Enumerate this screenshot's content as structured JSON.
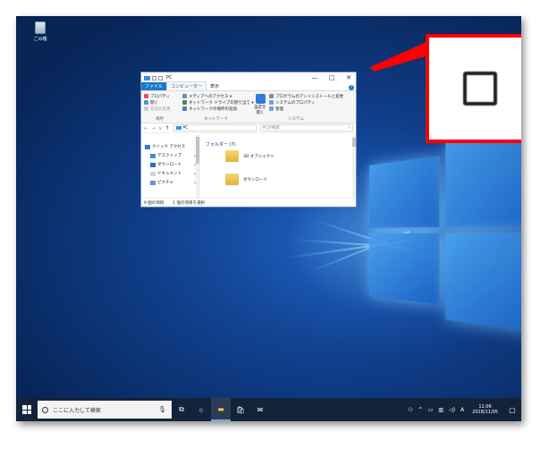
{
  "desktop": {
    "recycle_bin_label": "ごみ箱"
  },
  "explorer": {
    "title": "PC",
    "controls": {
      "minimize": "—",
      "maximize": "□",
      "close": "✕"
    },
    "tabs": [
      {
        "label": "ファイル"
      },
      {
        "label": "コンピューター"
      },
      {
        "label": "表示"
      }
    ],
    "help_label": "?",
    "ribbon": {
      "location_items": [
        "プロパティ",
        "開く",
        "名前の変更"
      ],
      "location_group": "場所",
      "network_items": [
        "メディアへのアクセス ▾",
        "ネットワーク ドライブの割り当て ▾",
        "ネットワークの場所の追加"
      ],
      "network_group": "ネットワーク",
      "settings_label": "設定を開く",
      "system_items": [
        "プログラムのアンインストールと変更",
        "システムのプロパティ",
        "管理"
      ],
      "system_group": "システム"
    },
    "address": {
      "back": "←",
      "forward": "→",
      "recent": "∨",
      "up": "↑",
      "path": "PC",
      "search_placeholder": "PCの検索"
    },
    "nav": [
      {
        "label": "クイック アクセス"
      },
      {
        "label": "デスクトップ"
      },
      {
        "label": "ダウンロード"
      },
      {
        "label": "ドキュメント"
      },
      {
        "label": "ピクチャ"
      }
    ],
    "pin_glyph": "✎",
    "folders_header": "フォルダー (7)",
    "folders": [
      {
        "name": "3D オブジェクト"
      },
      {
        "name": "ダウンロード"
      }
    ],
    "status": {
      "items": "9 個の項目",
      "selected": "1 個の項目を選択"
    }
  },
  "callout": {
    "border_color": "#ff0000",
    "icon": "maximize-icon"
  },
  "taskbar": {
    "search_placeholder": "ここに入力して検索",
    "time": "11:06",
    "date": "2018/11/05",
    "ime": "A"
  }
}
